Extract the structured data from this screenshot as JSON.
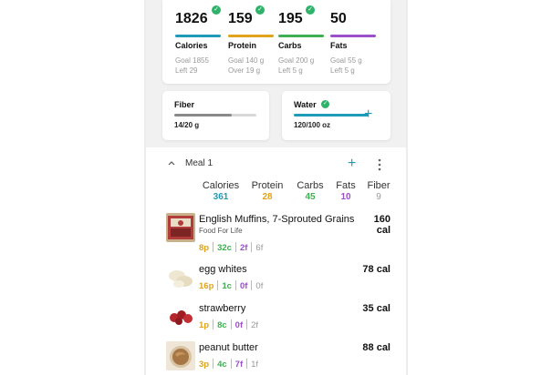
{
  "colors": {
    "calories": "#1e9bb7",
    "protein": "#e0a31a",
    "carbs": "#3faf52",
    "fats": "#9b4fc8",
    "fiber": "#9a9a9a",
    "check": "#2fb36b"
  },
  "macros": [
    {
      "value": "1826",
      "label": "Calories",
      "goal": "Goal 1855",
      "remaining": "Left 29",
      "checked": true
    },
    {
      "value": "159",
      "label": "Protein",
      "goal": "Goal 140 g",
      "remaining": "Over 19 g",
      "checked": true
    },
    {
      "value": "195",
      "label": "Carbs",
      "goal": "Goal 200 g",
      "remaining": "Left 5 g",
      "checked": true
    },
    {
      "value": "50",
      "label": "Fats",
      "goal": "Goal 55 g",
      "remaining": "Left 5 g",
      "checked": false
    }
  ],
  "fiber": {
    "title": "Fiber",
    "value": "14/20 g",
    "progress": 0.7
  },
  "water": {
    "title": "Water",
    "value": "120/100 oz",
    "progress": 1.0,
    "checked": true
  },
  "meal": {
    "title": "Meal 1",
    "totals": [
      {
        "label": "Calories",
        "value": "361"
      },
      {
        "label": "Protein",
        "value": "28"
      },
      {
        "label": "Carbs",
        "value": "45"
      },
      {
        "label": "Fats",
        "value": "10"
      },
      {
        "label": "Fiber",
        "value": "9"
      }
    ],
    "foods": [
      {
        "name": "English Muffins, 7-Sprouted Grains",
        "brand": "Food For Life",
        "cal1": "160",
        "cal2": "cal",
        "p": "8p",
        "c": "32c",
        "f": "2f",
        "fi": "6f"
      },
      {
        "name": "egg whites",
        "brand": "",
        "cal1": "78 cal",
        "cal2": "",
        "p": "16p",
        "c": "1c",
        "f": "0f",
        "fi": "0f"
      },
      {
        "name": "strawberry",
        "brand": "",
        "cal1": "35 cal",
        "cal2": "",
        "p": "1p",
        "c": "8c",
        "f": "0f",
        "fi": "2f"
      },
      {
        "name": "peanut butter",
        "brand": "",
        "cal1": "88 cal",
        "cal2": "",
        "p": "3p",
        "c": "4c",
        "f": "7f",
        "fi": "1f"
      }
    ]
  }
}
